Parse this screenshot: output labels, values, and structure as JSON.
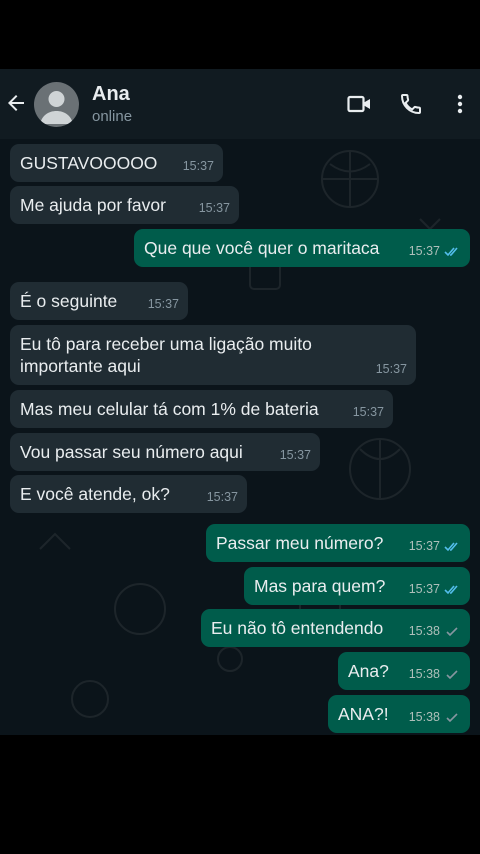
{
  "contact": {
    "name": "Ana",
    "status": "online"
  },
  "icons": {
    "back": "arrow-left-icon",
    "video": "video-call-icon",
    "call": "phone-icon",
    "menu": "more-vert-icon"
  },
  "colors": {
    "background": "#0b141a",
    "header": "#111b21",
    "incoming": "#202c33",
    "outgoing": "#005c4b",
    "read_tick": "#53bdeb",
    "sent_tick": "#8696a0"
  },
  "messages": [
    {
      "dir": "in",
      "text": "GUSTAVOOOOO",
      "time": "15:37"
    },
    {
      "dir": "in",
      "text": "Me ajuda por favor",
      "time": "15:37"
    },
    {
      "dir": "out",
      "text": "Que que você quer o maritaca",
      "time": "15:37",
      "status": "read"
    },
    {
      "dir": "in",
      "text": "É o seguinte",
      "time": "15:37"
    },
    {
      "dir": "in",
      "text": "Eu tô para receber uma ligação muito",
      "text2": "importante aqui",
      "time": "15:37"
    },
    {
      "dir": "in",
      "text": "Mas meu celular tá com 1% de bateria",
      "time": "15:37"
    },
    {
      "dir": "in",
      "text": "Vou passar seu número aqui",
      "time": "15:37"
    },
    {
      "dir": "in",
      "text": "E você atende, ok?",
      "time": "15:37"
    },
    {
      "dir": "out",
      "text": "Passar meu número?",
      "time": "15:37",
      "status": "read"
    },
    {
      "dir": "out",
      "text": "Mas para quem?",
      "time": "15:37",
      "status": "read"
    },
    {
      "dir": "out",
      "text": "Eu não tô entendendo",
      "time": "15:38",
      "status": "delivered"
    },
    {
      "dir": "out",
      "text": "Ana?",
      "time": "15:38",
      "status": "delivered"
    },
    {
      "dir": "out",
      "text": "ANA?!",
      "time": "15:38",
      "status": "delivered"
    }
  ]
}
